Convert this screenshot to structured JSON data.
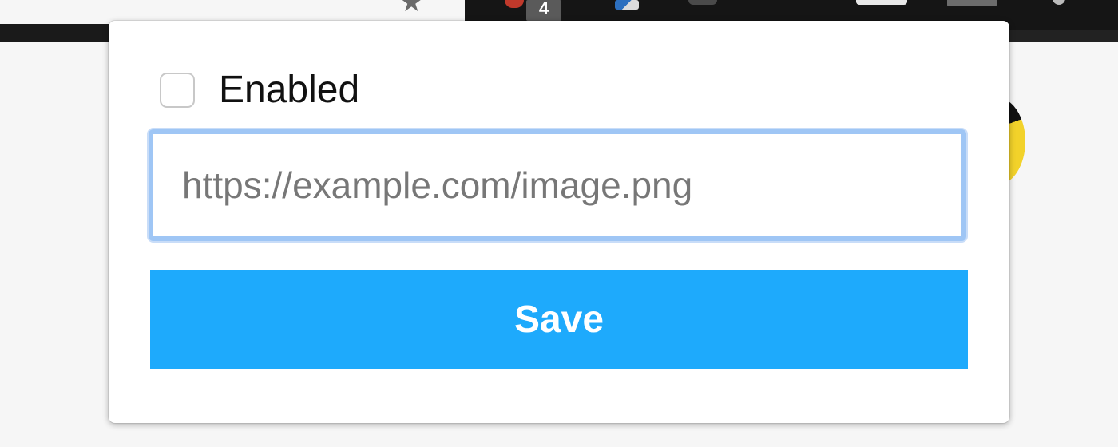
{
  "browser_toolbar": {
    "extension_badge_count": "4",
    "icons": [
      "bookmark-star-icon",
      "extension-red-icon",
      "extension-blue-icon",
      "extension-puzzle-icon",
      "extension-white-icon",
      "extension-grey-icon",
      "extension-menu-icon"
    ]
  },
  "popup": {
    "enabled_label": "Enabled",
    "enabled_checked": false,
    "url_input": {
      "value": "",
      "placeholder": "https://example.com/image.png"
    },
    "save_label": "Save"
  },
  "colors": {
    "save_button": "#1eaafc",
    "focus_ring": "#9fc6f5"
  }
}
